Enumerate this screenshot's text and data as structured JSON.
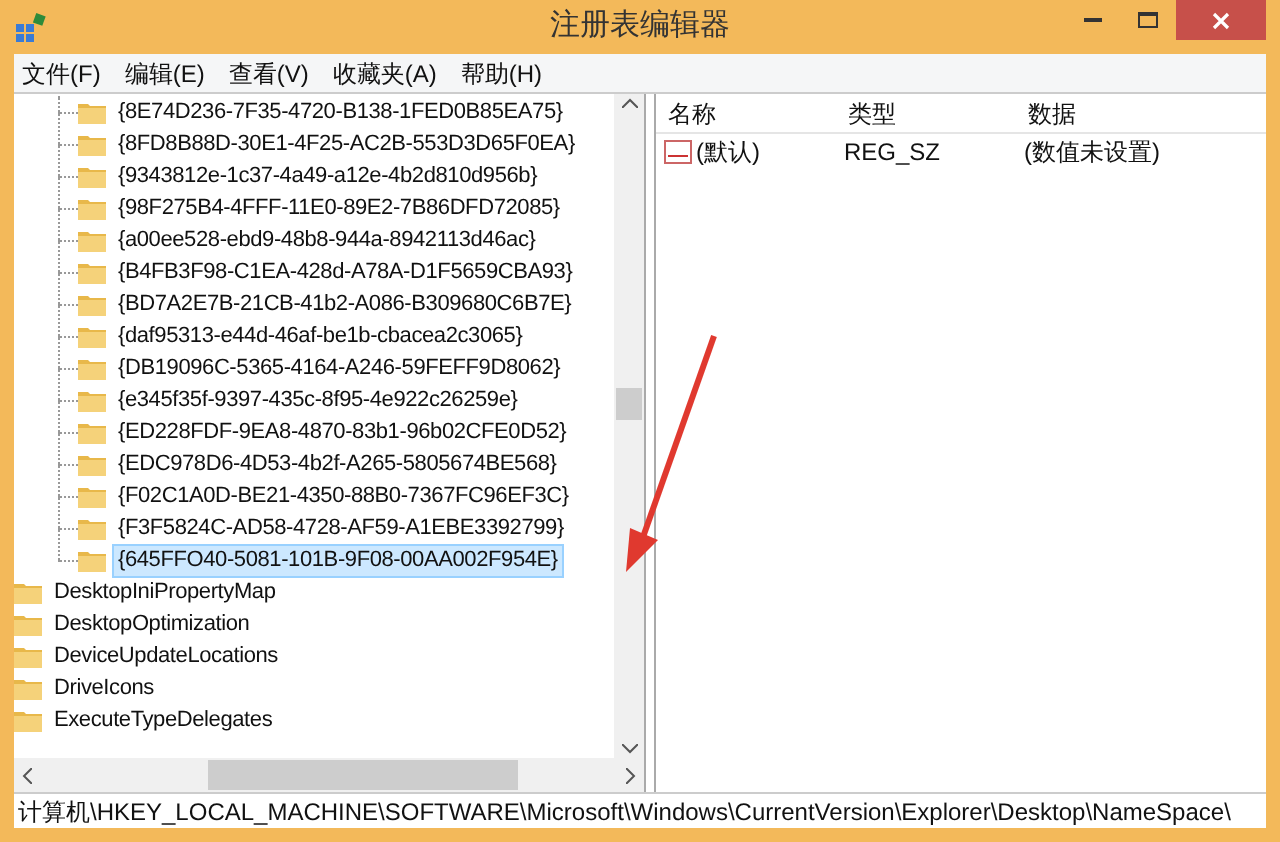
{
  "window": {
    "title": "注册表编辑器"
  },
  "menu": [
    "文件(F)",
    "编辑(E)",
    "查看(V)",
    "收藏夹(A)",
    "帮助(H)"
  ],
  "tree": {
    "items": [
      {
        "children": [
          {
            "label": "{8E74D236-7F35-4720-B138-1FED0B85EA75}",
            "selected": false
          },
          {
            "label": "{8FD8B88D-30E1-4F25-AC2B-553D3D65F0EA}",
            "selected": false
          },
          {
            "label": "{9343812e-1c37-4a49-a12e-4b2d810d956b}",
            "selected": false
          },
          {
            "label": "{98F275B4-4FFF-11E0-89E2-7B86DFD72085}",
            "selected": false
          },
          {
            "label": "{a00ee528-ebd9-48b8-944a-8942113d46ac}",
            "selected": false
          },
          {
            "label": "{B4FB3F98-C1EA-428d-A78A-D1F5659CBA93}",
            "selected": false
          },
          {
            "label": "{BD7A2E7B-21CB-41b2-A086-B309680C6B7E}",
            "selected": false
          },
          {
            "label": "{daf95313-e44d-46af-be1b-cbacea2c3065}",
            "selected": false
          },
          {
            "label": "{DB19096C-5365-4164-A246-59FEFF9D8062}",
            "selected": false
          },
          {
            "label": "{e345f35f-9397-435c-8f95-4e922c26259e}",
            "selected": false
          },
          {
            "label": "{ED228FDF-9EA8-4870-83b1-96b02CFE0D52}",
            "selected": false
          },
          {
            "label": "{EDC978D6-4D53-4b2f-A265-5805674BE568}",
            "selected": false
          },
          {
            "label": "{F02C1A0D-BE21-4350-88B0-7367FC96EF3C}",
            "selected": false
          },
          {
            "label": "{F3F5824C-AD58-4728-AF59-A1EBE3392799}",
            "selected": false
          },
          {
            "label": "{645FFO40-5081-101B-9F08-00AA002F954E}",
            "selected": true
          }
        ]
      },
      {
        "label": "DesktopIniPropertyMap",
        "selected": false
      },
      {
        "label": "DesktopOptimization",
        "selected": false
      },
      {
        "label": "DeviceUpdateLocations",
        "selected": false
      },
      {
        "label": "DriveIcons",
        "selected": false
      },
      {
        "label": "ExecuteTypeDelegates",
        "selected": false
      }
    ]
  },
  "values": {
    "columns": [
      "名称",
      "类型",
      "数据"
    ],
    "rows": [
      [
        "(默认)",
        "REG_SZ",
        "(数值未设置)"
      ]
    ]
  },
  "status_bar": "计算机\\HKEY_LOCAL_MACHINE\\SOFTWARE\\Microsoft\\Windows\\CurrentVersion\\Explorer\\Desktop\\NameSpace\\"
}
